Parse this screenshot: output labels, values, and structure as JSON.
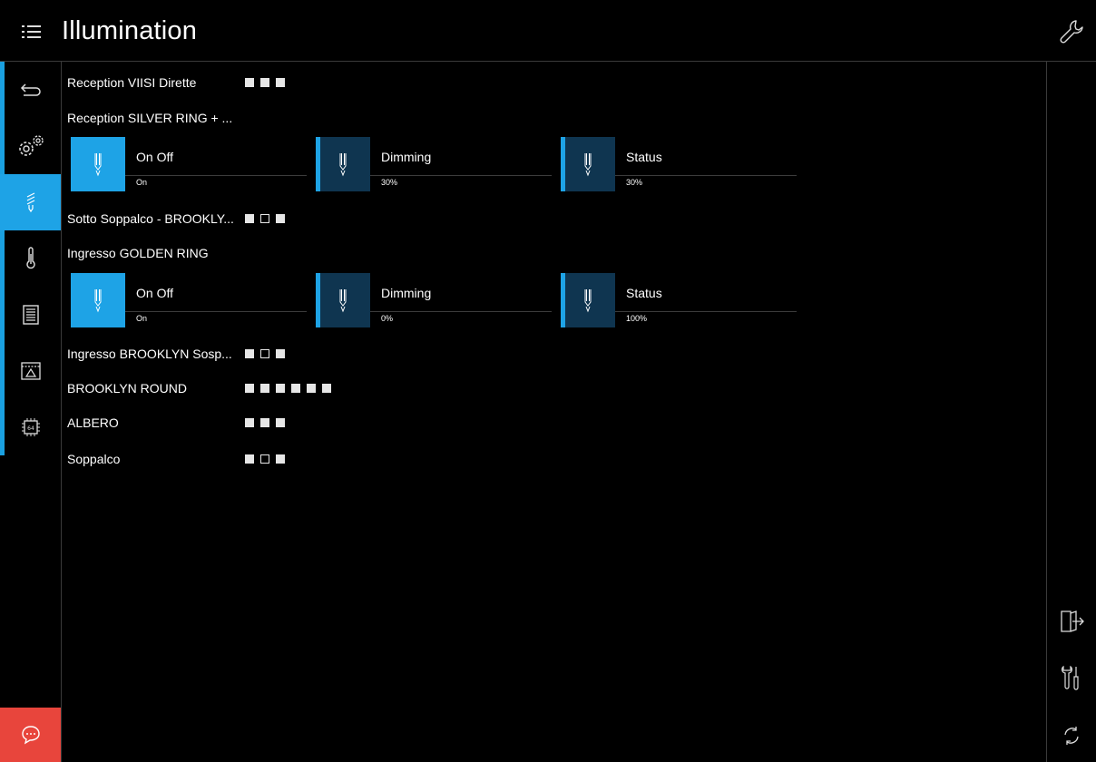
{
  "header": {
    "title": "Illumination"
  },
  "sidebar": {
    "items": [
      {
        "icon": "back-arrow-icon"
      },
      {
        "icon": "gears-icon"
      },
      {
        "icon": "light-bulb-icon"
      },
      {
        "icon": "thermometer-icon"
      },
      {
        "icon": "blinds-icon"
      },
      {
        "icon": "alarm-icon"
      },
      {
        "icon": "chip-64-icon"
      }
    ],
    "chat_icon": "chat-icon"
  },
  "rightbar": {
    "items": [
      {
        "icon": "logout-icon"
      },
      {
        "icon": "tools-icon"
      },
      {
        "icon": "refresh-icon"
      }
    ]
  },
  "groups": [
    {
      "name": "Reception VIISI Dirette",
      "dots": [
        1,
        1,
        1
      ]
    },
    {
      "name": "Reception SILVER RING + ...",
      "dots": []
    },
    {
      "name": "Sotto Soppalco - BROOKLY...",
      "dots": [
        1,
        0,
        1
      ]
    },
    {
      "name": "Ingresso GOLDEN RING",
      "dots": []
    },
    {
      "name": "Ingresso BROOKLYN Sosp...",
      "dots": [
        1,
        0,
        1
      ]
    },
    {
      "name": "BROOKLYN ROUND",
      "dots": [
        1,
        1,
        1,
        1,
        1,
        1
      ]
    },
    {
      "name": "ALBERO",
      "dots": [
        1,
        1,
        1
      ]
    },
    {
      "name": "Soppalco",
      "dots": [
        1,
        0,
        1
      ]
    }
  ],
  "tiles_silver": [
    {
      "label": "On Off",
      "value": "On"
    },
    {
      "label": "Dimming",
      "value": "30%"
    },
    {
      "label": "Status",
      "value": "30%"
    }
  ],
  "tiles_golden": [
    {
      "label": "On Off",
      "value": "On"
    },
    {
      "label": "Dimming",
      "value": "0%"
    },
    {
      "label": "Status",
      "value": "100%"
    }
  ],
  "colors": {
    "accent": "#1ea3e6",
    "tile_dark": "#0f3550",
    "chat": "#e8453c"
  }
}
